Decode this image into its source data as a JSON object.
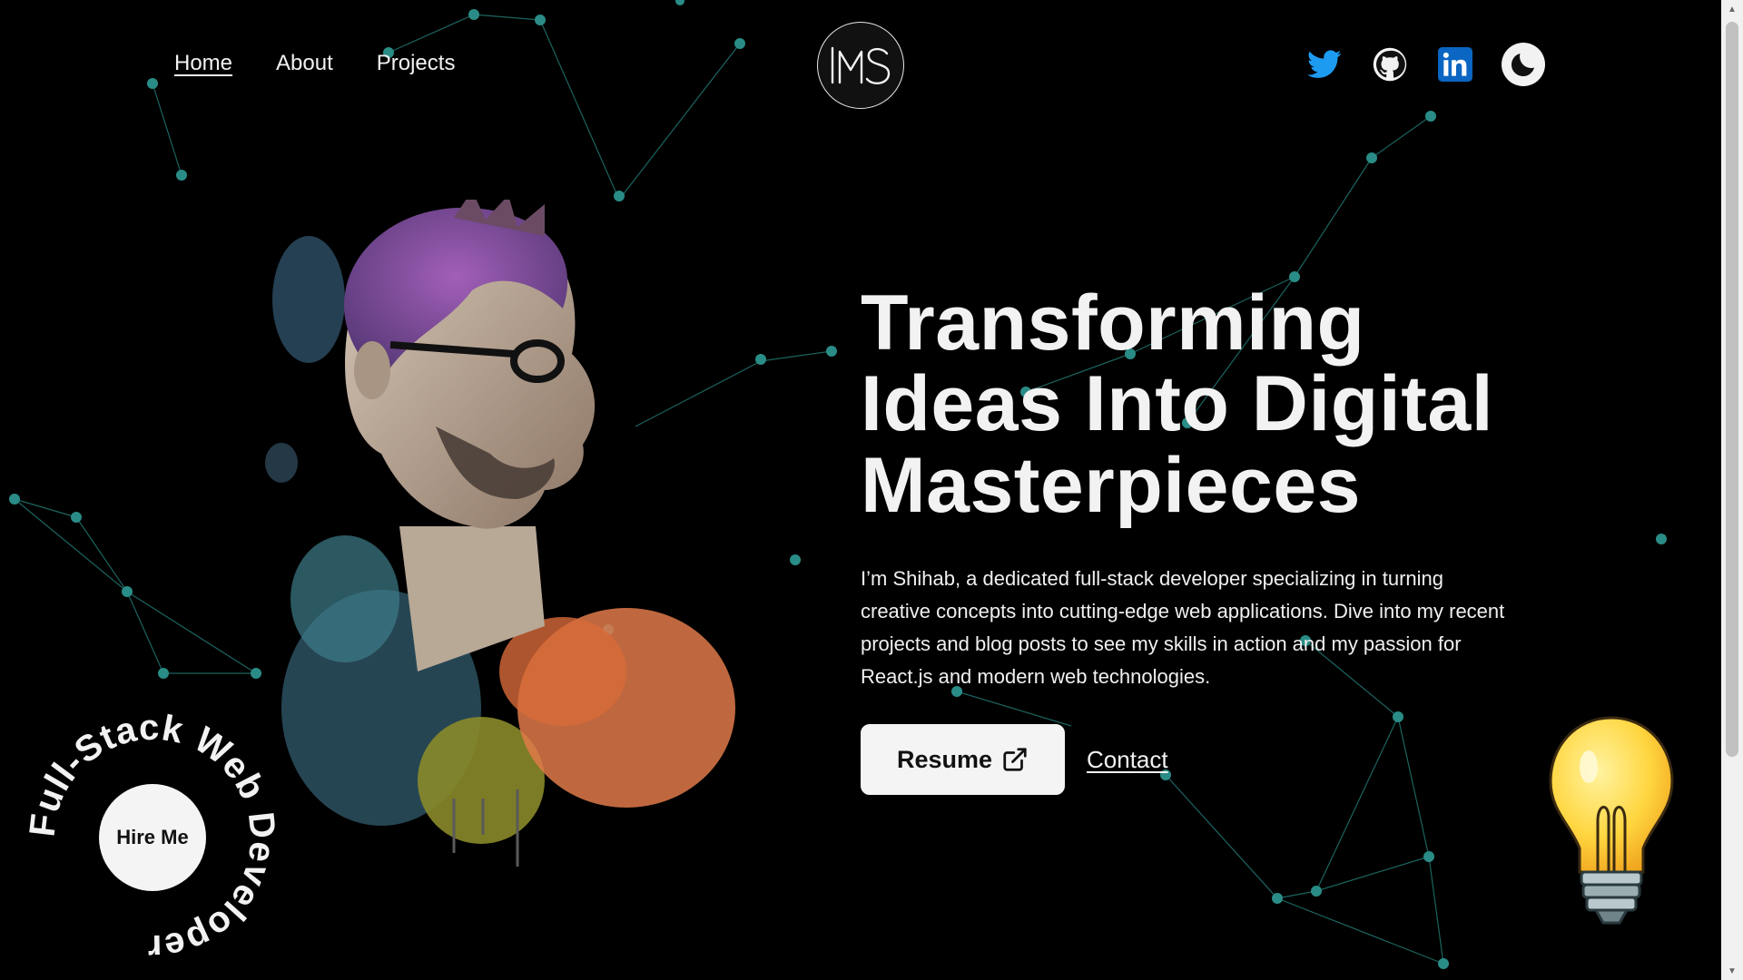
{
  "nav": {
    "items": [
      {
        "label": "Home",
        "active": true
      },
      {
        "label": "About",
        "active": false
      },
      {
        "label": "Projects",
        "active": false
      }
    ]
  },
  "logo": {
    "text": "MS"
  },
  "social": {
    "icons": [
      "twitter-icon",
      "github-icon",
      "linkedin-icon",
      "moon-icon"
    ],
    "colors": {
      "twitter": "#1d9bf0",
      "linkedin": "#0a66c2"
    }
  },
  "hero": {
    "title_lines": [
      "Transforming",
      "Ideas Into Digital",
      "Masterpieces"
    ],
    "description": "I’m Shihab, a dedicated full-stack developer specializing in turning creative concepts into cutting-edge web applications. Dive into my recent projects and blog posts to see my skills in action and my passion for React.js and modern web technologies.",
    "resume_label": "Resume",
    "contact_label": "Contact"
  },
  "badge": {
    "ring_text": "Full-Stack Web Developer ",
    "hire_label": "Hire Me"
  },
  "theme": {
    "accent": "#2a8c86",
    "background": "#000000",
    "text": "#f2f2f2"
  }
}
